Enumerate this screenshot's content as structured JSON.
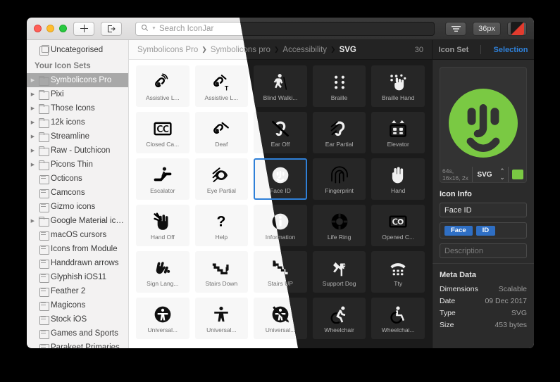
{
  "window": {
    "toolbar": {
      "add_label": "+",
      "export_label": "export-icon",
      "size_label": "36px",
      "filter_label": "filter-icon",
      "color_swatch": "#e23b2e"
    },
    "search": {
      "placeholder": "Search IconJar",
      "value": ""
    }
  },
  "sidebar": {
    "uncategorised": "Uncategorised",
    "section_title": "Your Icon Sets",
    "items": [
      {
        "label": "Symbolicons Pro",
        "icon": "folder",
        "expandable": true,
        "selected": true
      },
      {
        "label": "Pixi",
        "icon": "folder",
        "expandable": true,
        "selected": false
      },
      {
        "label": "Those Icons",
        "icon": "folder",
        "expandable": true,
        "selected": false
      },
      {
        "label": "12k icons",
        "icon": "folder",
        "expandable": true,
        "selected": false
      },
      {
        "label": "Streamline",
        "icon": "folder",
        "expandable": true,
        "selected": false
      },
      {
        "label": "Raw - Dutchicon",
        "icon": "folder",
        "expandable": true,
        "selected": false
      },
      {
        "label": "Picons Thin",
        "icon": "folder",
        "expandable": true,
        "selected": false
      },
      {
        "label": "Octicons",
        "icon": "box",
        "expandable": false,
        "selected": false
      },
      {
        "label": "Camcons",
        "icon": "box",
        "expandable": false,
        "selected": false
      },
      {
        "label": "Gizmo icons",
        "icon": "box",
        "expandable": false,
        "selected": false
      },
      {
        "label": "Google Material ico...",
        "icon": "folder",
        "expandable": true,
        "selected": false
      },
      {
        "label": "macOS cursors",
        "icon": "box",
        "expandable": false,
        "selected": false
      },
      {
        "label": "Icons from Module",
        "icon": "box",
        "expandable": false,
        "selected": false
      },
      {
        "label": "Handdrawn arrows",
        "icon": "box",
        "expandable": false,
        "selected": false
      },
      {
        "label": "Glyphish iOS11",
        "icon": "box",
        "expandable": false,
        "selected": false
      },
      {
        "label": "Feather 2",
        "icon": "box",
        "expandable": false,
        "selected": false
      },
      {
        "label": "Magicons",
        "icon": "box",
        "expandable": false,
        "selected": false
      },
      {
        "label": "Stock iOS",
        "icon": "box",
        "expandable": false,
        "selected": false
      },
      {
        "label": "Games and Sports",
        "icon": "box",
        "expandable": false,
        "selected": false
      },
      {
        "label": "Parakeet Primaries",
        "icon": "box",
        "expandable": false,
        "selected": false
      }
    ]
  },
  "breadcrumb": {
    "parts": [
      "Symbolicons Pro",
      "Symbolicons pro",
      "Accessibility",
      "SVG"
    ],
    "count": "30"
  },
  "grid": {
    "icons": [
      {
        "label": "Assistive L...",
        "icon": "assistive-listening-icon"
      },
      {
        "label": "Assistive L...",
        "icon": "assistive-listening-t-icon"
      },
      {
        "label": "Blind Walki...",
        "icon": "blind-walking-icon"
      },
      {
        "label": "Braille",
        "icon": "braille-icon"
      },
      {
        "label": "Braille Hand",
        "icon": "braille-hand-icon"
      },
      {
        "label": "Closed Ca...",
        "icon": "closed-captions-icon"
      },
      {
        "label": "Deaf",
        "icon": "deaf-icon"
      },
      {
        "label": "Ear Off",
        "icon": "ear-off-icon"
      },
      {
        "label": "Ear Partial",
        "icon": "ear-partial-icon"
      },
      {
        "label": "Elevator",
        "icon": "elevator-icon"
      },
      {
        "label": "Escalator",
        "icon": "escalator-icon"
      },
      {
        "label": "Eye Partial",
        "icon": "eye-partial-icon"
      },
      {
        "label": "Face ID",
        "icon": "face-id-icon",
        "selected": true
      },
      {
        "label": "Fingerprint",
        "icon": "fingerprint-icon"
      },
      {
        "label": "Hand",
        "icon": "hand-icon"
      },
      {
        "label": "Hand Off",
        "icon": "hand-off-icon"
      },
      {
        "label": "Help",
        "icon": "help-icon"
      },
      {
        "label": "Information",
        "icon": "information-icon"
      },
      {
        "label": "Life Ring",
        "icon": "life-ring-icon"
      },
      {
        "label": "Opened C...",
        "icon": "opened-captions-icon"
      },
      {
        "label": "Sign Lang...",
        "icon": "sign-language-icon"
      },
      {
        "label": "Stairs Down",
        "icon": "stairs-down-icon"
      },
      {
        "label": "Stairs UP",
        "icon": "stairs-up-icon"
      },
      {
        "label": "Support Dog",
        "icon": "support-dog-icon"
      },
      {
        "label": "Tty",
        "icon": "tty-icon"
      },
      {
        "label": "Universal...",
        "icon": "universal-access-circle-icon"
      },
      {
        "label": "Universal...",
        "icon": "universal-access-icon"
      },
      {
        "label": "Universal...",
        "icon": "universal-access-off-icon"
      },
      {
        "label": "Wheelchair",
        "icon": "wheelchair-active-icon"
      },
      {
        "label": "Wheelchai...",
        "icon": "wheelchair-icon"
      }
    ]
  },
  "inspector": {
    "tabs": [
      {
        "label": "Icon Set",
        "active": false
      },
      {
        "label": "Selection",
        "active": true
      }
    ],
    "preview": {
      "icon": "face-id-icon",
      "color": "#7ac943",
      "dimensions_label": "64s, 16x16, 2x",
      "format": "SVG",
      "stepper": "stepper-icon"
    },
    "icon_info": {
      "title": "Icon Info",
      "name": "Face ID",
      "tags": [
        "Face",
        "ID"
      ],
      "description_placeholder": "Description"
    },
    "meta": {
      "title": "Meta Data",
      "rows": [
        {
          "key": "Dimensions",
          "value": "Scalable"
        },
        {
          "key": "Date",
          "value": "09 Dec 2017"
        },
        {
          "key": "Type",
          "value": "SVG"
        },
        {
          "key": "Size",
          "value": "453 bytes"
        }
      ]
    }
  }
}
